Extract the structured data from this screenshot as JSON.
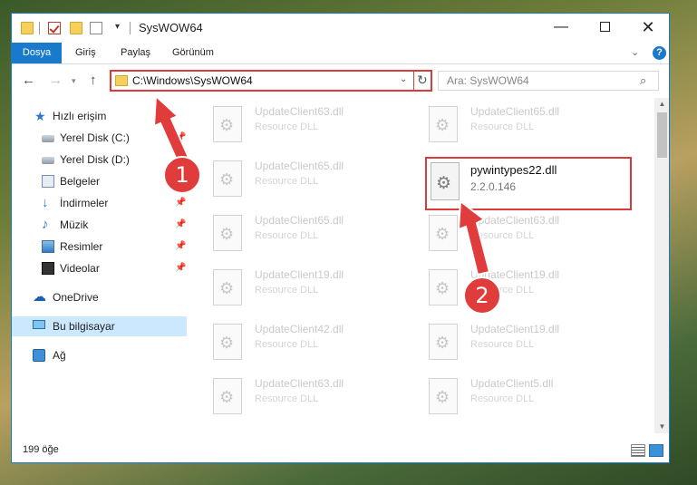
{
  "window": {
    "title": "SysWOW64",
    "qat_dropdown": "▾"
  },
  "controls": {
    "minimize": "—",
    "close": "✕"
  },
  "ribbon": {
    "tabs": [
      "Dosya",
      "Giriş",
      "Paylaş",
      "Görünüm"
    ],
    "collapse": "⌄",
    "help": "?"
  },
  "nav": {
    "back": "←",
    "forward": "→",
    "recent": "▾",
    "up": "↑",
    "address": "C:\\Windows\\SysWOW64",
    "address_dropdown": "⌄",
    "refresh": "↻",
    "search_placeholder": "Ara: SysWOW64",
    "search_glyph": "⌕"
  },
  "sidebar": {
    "items": [
      {
        "label": "Hızlı erişim",
        "icon": "star-icon",
        "pinned": false
      },
      {
        "label": "Yerel Disk (C:)",
        "icon": "drive-icon",
        "pinned": true
      },
      {
        "label": "Yerel Disk (D:)",
        "icon": "drive-icon",
        "pinned": false
      },
      {
        "label": "Belgeler",
        "icon": "documents-icon",
        "pinned": true
      },
      {
        "label": "İndirmeler",
        "icon": "download-icon",
        "pinned": true
      },
      {
        "label": "Müzik",
        "icon": "music-icon",
        "pinned": true
      },
      {
        "label": "Resimler",
        "icon": "pictures-icon",
        "pinned": true
      },
      {
        "label": "Videolar",
        "icon": "video-icon",
        "pinned": true
      },
      {
        "label": "OneDrive",
        "icon": "cloud-icon",
        "pinned": false
      },
      {
        "label": "Bu bilgisayar",
        "icon": "computer-icon",
        "pinned": false,
        "selected": true
      },
      {
        "label": "Ağ",
        "icon": "network-icon",
        "pinned": false
      }
    ],
    "pin_glyph": "📌"
  },
  "files": {
    "left": [
      {
        "name": "UpdateClient63.dll",
        "type": "Resource DLL"
      },
      {
        "name": "UpdateClient65.dll",
        "type": "Resource DLL"
      },
      {
        "name": "UpdateClient65.dll",
        "type": "Resource DLL"
      },
      {
        "name": "UpdateClient19.dll",
        "type": "Resource DLL"
      },
      {
        "name": "UpdateClient42.dll",
        "type": "Resource DLL"
      },
      {
        "name": "UpdateClient63.dll",
        "type": "Resource DLL"
      }
    ],
    "right": [
      {
        "name": "UpdateClient65.dll",
        "type": "Resource DLL"
      },
      {
        "name": "UpdateClient63.dll",
        "type": "Resource DLL"
      },
      {
        "name": "UpdateClient19.dll",
        "type": "Resource DLL"
      },
      {
        "name": "UpdateClient19.dll",
        "type": "Resource DLL"
      },
      {
        "name": "UpdateClient5.dll",
        "type": "Resource DLL"
      }
    ],
    "highlighted": {
      "name": "pywintypes22.dll",
      "type": "2.2.0.146"
    }
  },
  "status": {
    "count": "199 öğe"
  },
  "callouts": [
    "1",
    "2"
  ],
  "colors": {
    "accent": "#1979ca",
    "annotation": "#d93a3a"
  }
}
